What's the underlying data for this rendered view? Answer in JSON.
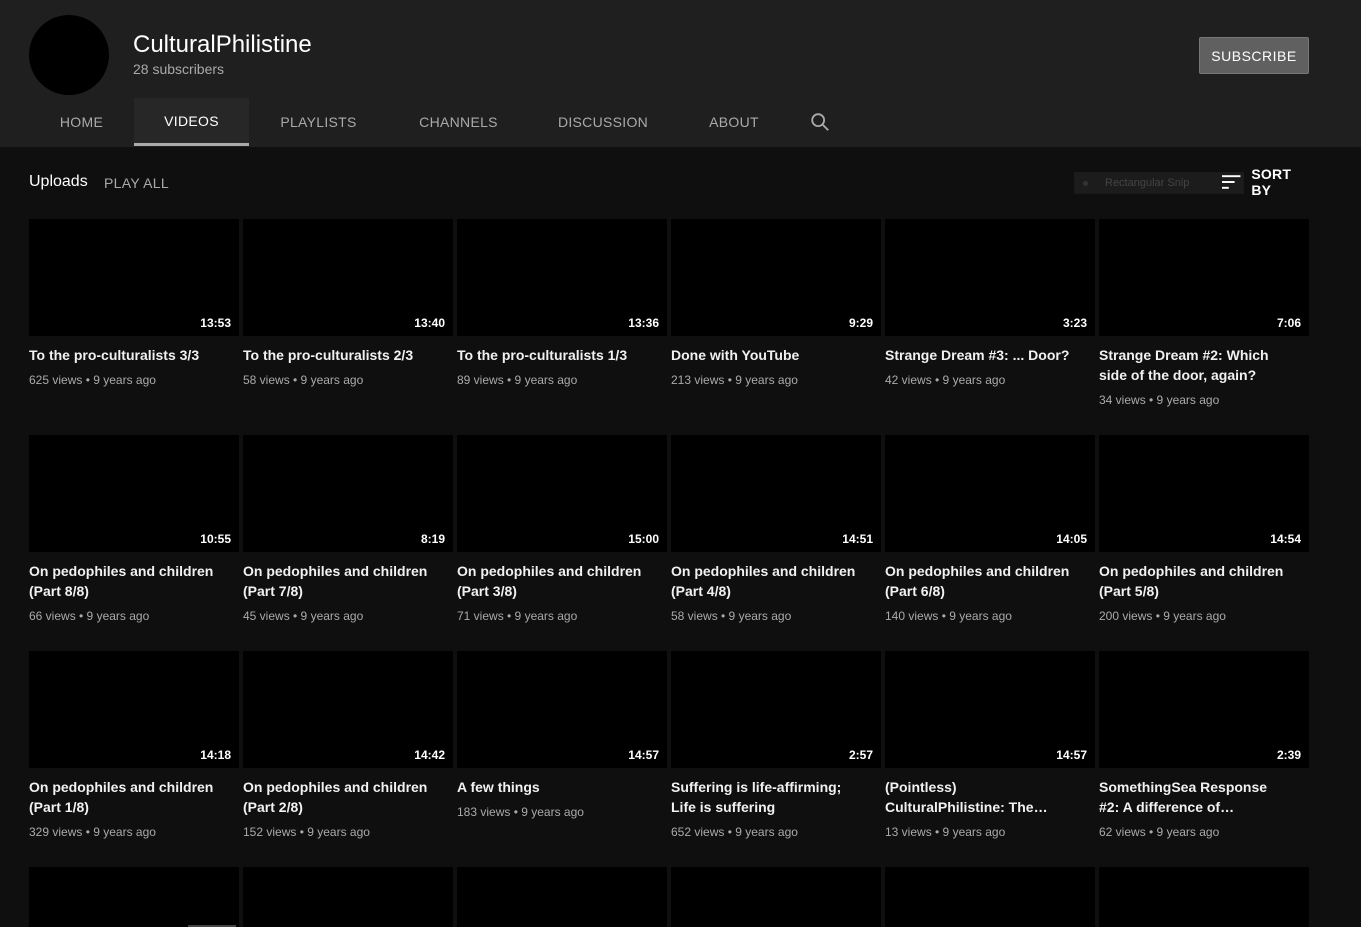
{
  "channel": {
    "name": "CulturalPhilistine",
    "subscribers": "28 subscribers",
    "subscribe_label": "SUBSCRIBE"
  },
  "tabs": [
    {
      "label": "HOME"
    },
    {
      "label": "VIDEOS"
    },
    {
      "label": "PLAYLISTS"
    },
    {
      "label": "CHANNELS"
    },
    {
      "label": "DISCUSSION"
    },
    {
      "label": "ABOUT"
    }
  ],
  "section": {
    "title": "Uploads",
    "play_all": "PLAY ALL",
    "sort_hint": "Rectangular Snip",
    "sort_label": "SORT BY"
  },
  "videos": [
    {
      "duration": "13:53",
      "title": "To the pro-culturalists 3/3",
      "meta": "625 views • 9 years ago"
    },
    {
      "duration": "13:40",
      "title": "To the pro-culturalists 2/3",
      "meta": "58 views • 9 years ago"
    },
    {
      "duration": "13:36",
      "title": "To the pro-culturalists 1/3",
      "meta": "89 views • 9 years ago"
    },
    {
      "duration": "9:29",
      "title": "Done with YouTube",
      "meta": "213 views • 9 years ago"
    },
    {
      "duration": "3:23",
      "title": "Strange Dream #3: ... Door?",
      "meta": "42 views • 9 years ago"
    },
    {
      "duration": "7:06",
      "title": "Strange Dream #2: Which side of the door, again?",
      "meta": "34 views • 9 years ago"
    },
    {
      "duration": "10:55",
      "title": "On pedophiles and children (Part 8/8)",
      "meta": "66 views • 9 years ago"
    },
    {
      "duration": "8:19",
      "title": "On pedophiles and children (Part 7/8)",
      "meta": "45 views • 9 years ago"
    },
    {
      "duration": "15:00",
      "title": "On pedophiles and children (Part 3/8)",
      "meta": "71 views • 9 years ago"
    },
    {
      "duration": "14:51",
      "title": "On pedophiles and children (Part 4/8)",
      "meta": "58 views • 9 years ago"
    },
    {
      "duration": "14:05",
      "title": "On pedophiles and children (Part 6/8)",
      "meta": "140 views • 9 years ago"
    },
    {
      "duration": "14:54",
      "title": "On pedophiles and children (Part 5/8)",
      "meta": "200 views • 9 years ago"
    },
    {
      "duration": "14:18",
      "title": "On pedophiles and children (Part 1/8)",
      "meta": "329 views • 9 years ago"
    },
    {
      "duration": "14:42",
      "title": "On pedophiles and children (Part 2/8)",
      "meta": "152 views • 9 years ago"
    },
    {
      "duration": "14:57",
      "title": "A few things",
      "meta": "183 views • 9 years ago"
    },
    {
      "duration": "2:57",
      "title": "Suffering is life-affirming; Life is suffering",
      "meta": "652 views • 9 years ago"
    },
    {
      "duration": "14:57",
      "title": "(Pointless) CulturalPhilistine: The…",
      "meta": "13 views • 9 years ago"
    },
    {
      "duration": "2:39",
      "title": "SomethingSea Response #2: A difference of…",
      "meta": "62 views • 9 years ago"
    }
  ]
}
